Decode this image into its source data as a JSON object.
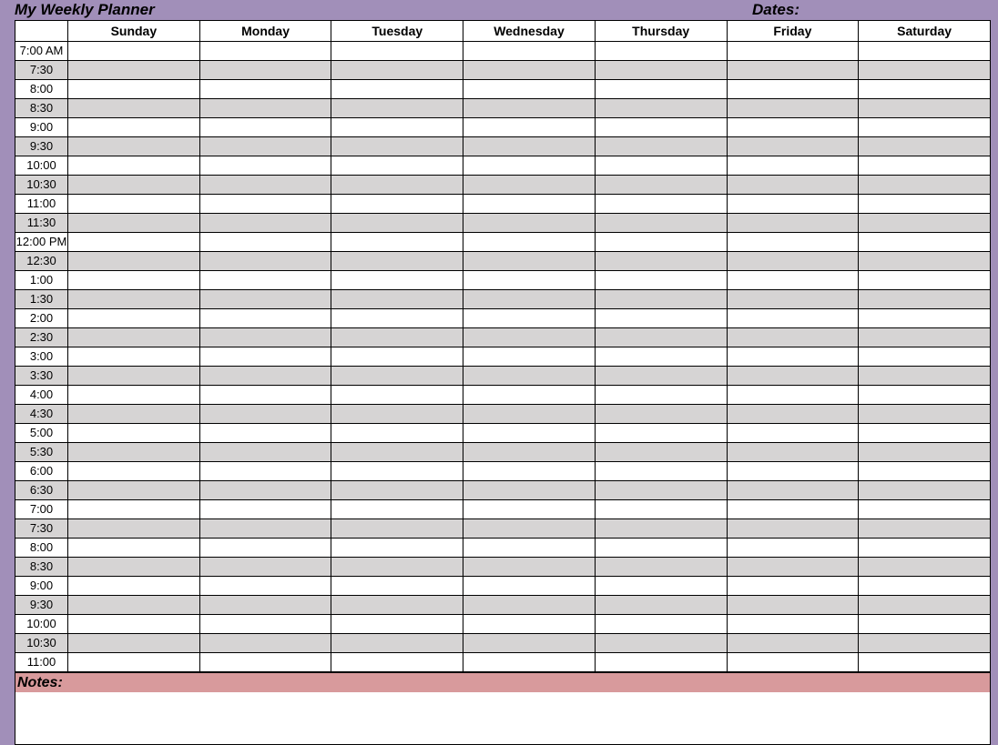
{
  "header": {
    "title": "My Weekly Planner",
    "dates_label": "Dates:"
  },
  "days": [
    "Sunday",
    "Monday",
    "Tuesday",
    "Wednesday",
    "Thursday",
    "Friday",
    "Saturday"
  ],
  "times": [
    "7:00 AM",
    "7:30",
    "8:00",
    "8:30",
    "9:00",
    "9:30",
    "10:00",
    "10:30",
    "11:00",
    "11:30",
    "12:00 PM",
    "12:30",
    "1:00",
    "1:30",
    "2:00",
    "2:30",
    "3:00",
    "3:30",
    "4:00",
    "4:30",
    "5:00",
    "5:30",
    "6:00",
    "6:30",
    "7:00",
    "7:30",
    "8:00",
    "8:30",
    "9:00",
    "9:30",
    "10:00",
    "10:30",
    "11:00"
  ],
  "notes": {
    "label": "Notes:",
    "value": ""
  }
}
